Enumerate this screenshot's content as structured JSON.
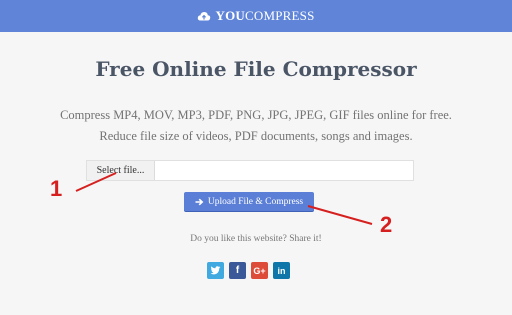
{
  "header": {
    "brand_bold": "YOU",
    "brand_rest": "COMPRESS",
    "icon": "cloud-upload-icon"
  },
  "main": {
    "title": "Free Online File Compressor",
    "description_line1": "Compress MP4, MOV, MP3, PDF, PNG, JPG, JPEG, GIF files online for free.",
    "description_line2": "Reduce file size of videos, PDF documents, songs and images.",
    "select_file_label": "Select file...",
    "file_input_value": "",
    "upload_button_label": "Upload File & Compress",
    "share_text": "Do you like this website? Share it!"
  },
  "social": [
    {
      "name": "twitter-icon",
      "glyph": ""
    },
    {
      "name": "facebook-icon",
      "glyph": "f"
    },
    {
      "name": "google-plus-icon",
      "glyph": "G+"
    },
    {
      "name": "linkedin-icon",
      "glyph": "in"
    }
  ],
  "annotations": {
    "step1": "1",
    "step2": "2",
    "color": "#d62020"
  },
  "colors": {
    "header_bg": "#5f84d8",
    "button_bg": "#5b7fd6",
    "page_bg": "#f6f6f6"
  }
}
